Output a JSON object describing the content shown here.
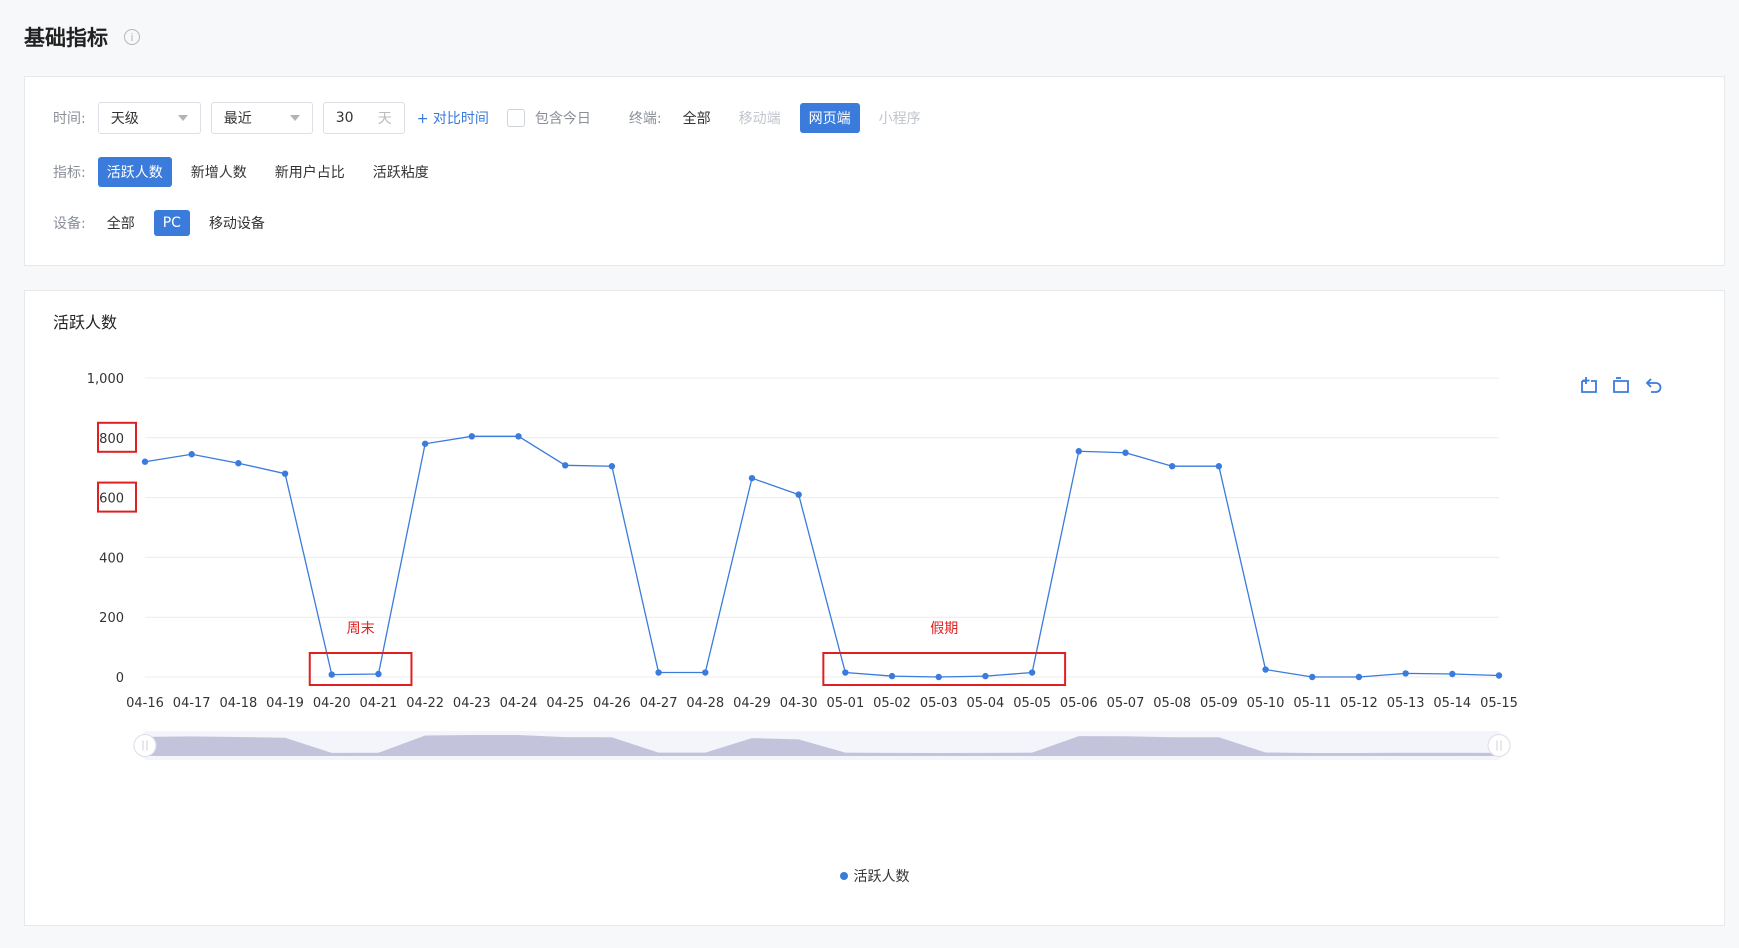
{
  "header": {
    "title": "基础指标",
    "info_icon": "info-icon",
    "info_glyph": "i"
  },
  "filters": {
    "time_label": "时间:",
    "granularity": "天级",
    "range": "最近",
    "days_value": "30",
    "days_unit": "天",
    "compare_link": "+ 对比时间",
    "include_today": "包含今日",
    "terminal_label": "终端:",
    "terminals": [
      "全部",
      "移动端",
      "网页端",
      "小程序"
    ],
    "active_terminal": "网页端",
    "metric_label": "指标:",
    "metrics": [
      "活跃人数",
      "新增人数",
      "新用户占比",
      "活跃粘度"
    ],
    "active_metric": "活跃人数",
    "device_label": "设备:",
    "devices": [
      "全部",
      "PC",
      "移动设备"
    ],
    "active_device": "PC"
  },
  "colors": {
    "accent": "#3a7bdc",
    "annotation": "#e02020",
    "zoom_fill": "#c3c4dc"
  },
  "toolbar": {
    "icons": [
      "zoom-select-icon",
      "zoom-reset-icon",
      "restore-icon"
    ]
  },
  "chart_data": {
    "type": "line",
    "title": "活跃人数",
    "x": [
      "04-16",
      "04-17",
      "04-18",
      "04-19",
      "04-20",
      "04-21",
      "04-22",
      "04-23",
      "04-24",
      "04-25",
      "04-26",
      "04-27",
      "04-28",
      "04-29",
      "04-30",
      "05-01",
      "05-02",
      "05-03",
      "05-04",
      "05-05",
      "05-06",
      "05-07",
      "05-08",
      "05-09",
      "05-10",
      "05-11",
      "05-12",
      "05-13",
      "05-14",
      "05-15"
    ],
    "series": [
      {
        "name": "活跃人数",
        "values": [
          720,
          745,
          715,
          680,
          8,
          10,
          780,
          805,
          805,
          708,
          705,
          15,
          15,
          665,
          610,
          15,
          3,
          0,
          3,
          15,
          755,
          750,
          705,
          705,
          25,
          0,
          0,
          12,
          10,
          5
        ]
      }
    ],
    "ylim": [
      0,
      1000
    ],
    "yticks": [
      0,
      200,
      400,
      600,
      800,
      1000
    ],
    "ytick_labels": [
      "0",
      "200",
      "400",
      "600",
      "800",
      "1,000"
    ],
    "grid": true,
    "legend": "bottom-center",
    "annotations": [
      {
        "text": "周末",
        "from": "04-20",
        "to": "04-21"
      },
      {
        "text": "假期",
        "from": "05-01",
        "to": "05-05"
      }
    ],
    "highlighted_ticks": [
      "800",
      "600"
    ]
  }
}
